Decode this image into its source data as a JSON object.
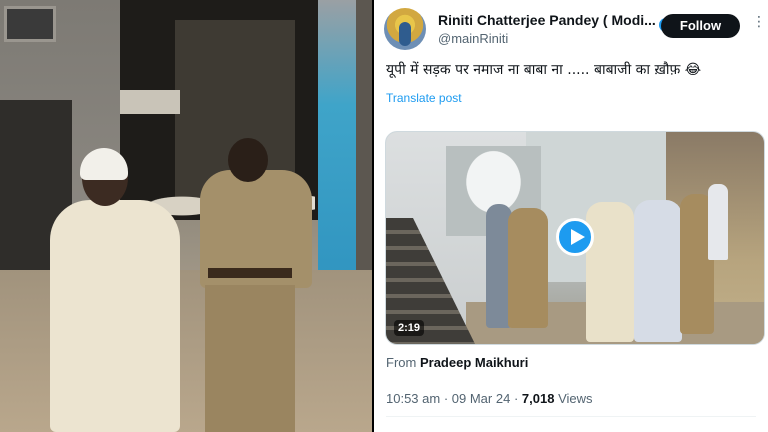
{
  "tweet": {
    "display_name": "Riniti Chatterjee Pandey ( Modi...",
    "handle": "@mainRiniti",
    "follow_label": "Follow",
    "text": "यूपी में सड़क पर नमाज ना बाबा ना ..... बाबाजी का ख़ौफ़ 😂",
    "translate_label": "Translate post",
    "video_duration": "2:19",
    "from_label": "From",
    "from_name": "Pradeep Maikhuri",
    "time": "10:53 am",
    "date": "09 Mar 24",
    "views_count": "7,018",
    "views_label": "Views",
    "verified_color": "#1d9bf0"
  }
}
